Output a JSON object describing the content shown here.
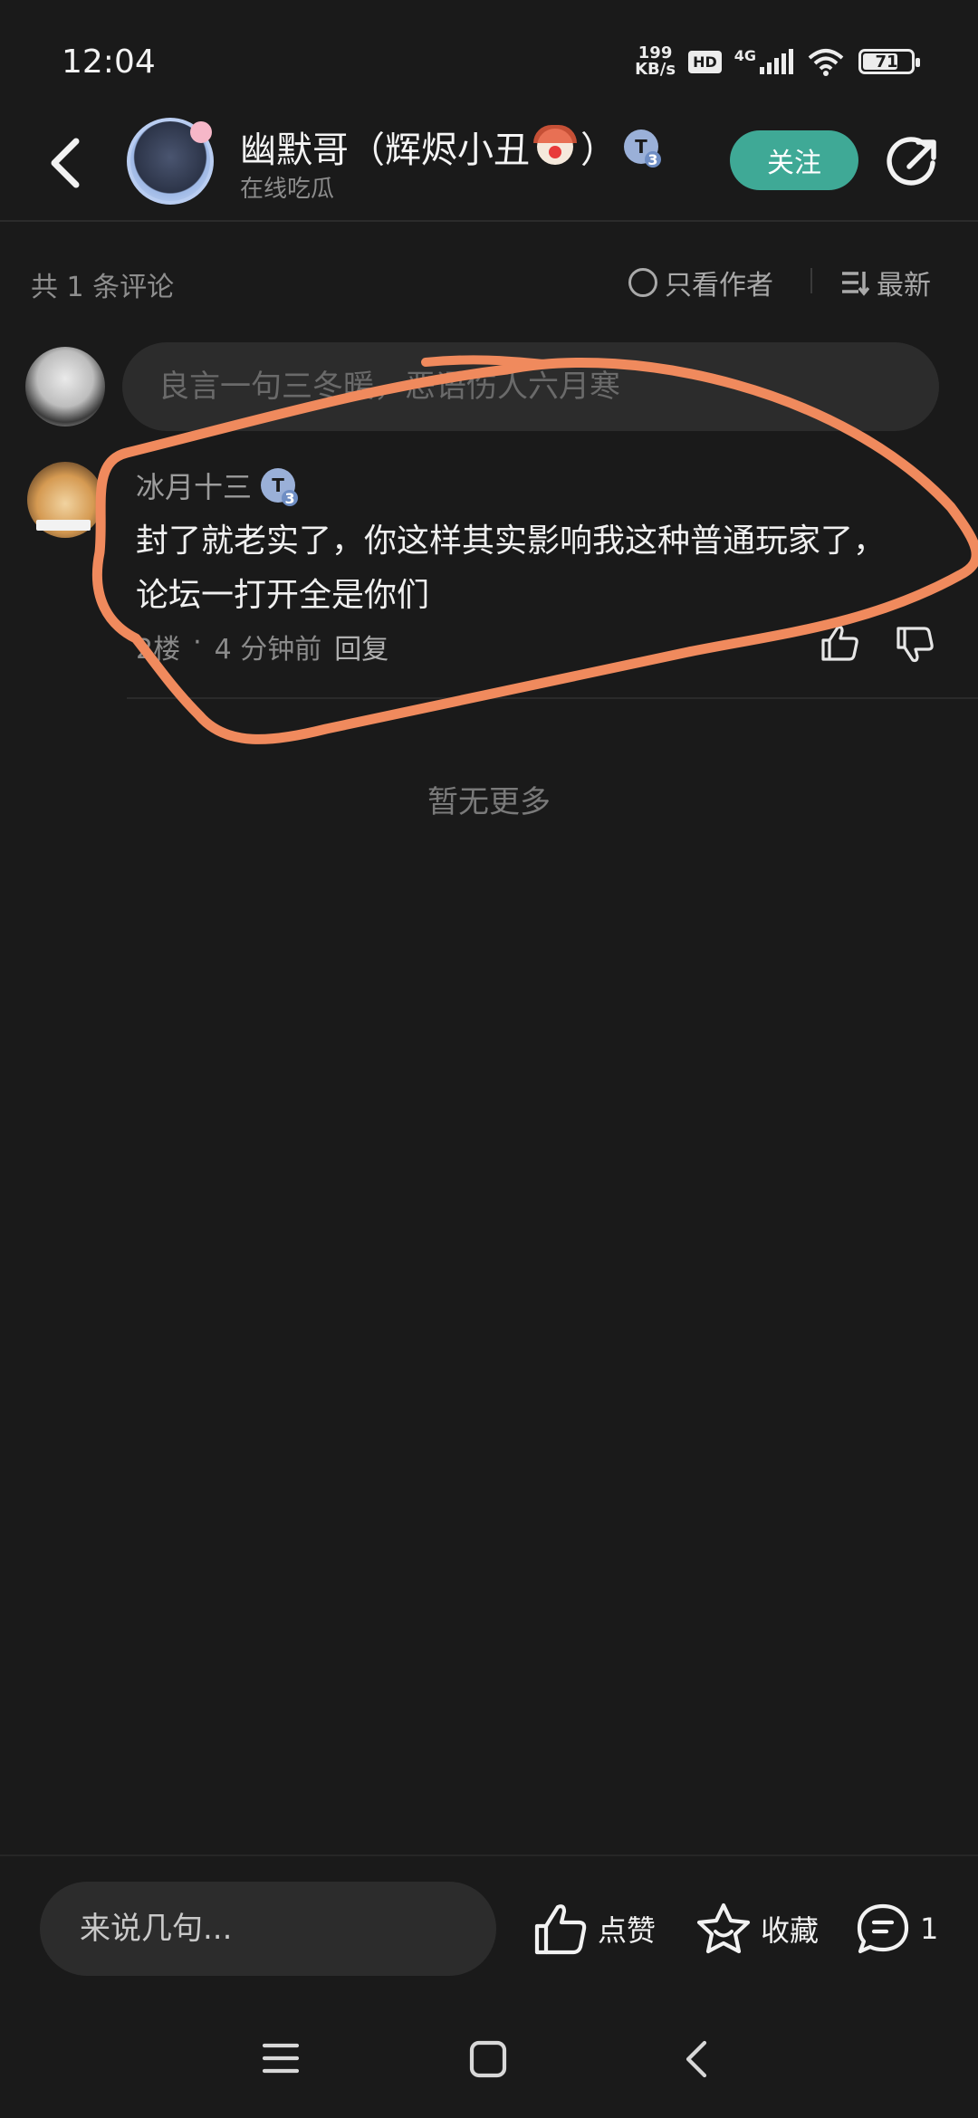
{
  "status_bar": {
    "time": "12:04",
    "net_speed_value": "199",
    "net_speed_unit": "KB/s",
    "hd": "HD",
    "network": "4G",
    "battery": "71"
  },
  "header": {
    "user_name": "幽默哥（辉烬小丑",
    "user_name_suffix": "）",
    "level_badge": "T",
    "level_num": "3",
    "subtitle": "在线吃瓜",
    "follow_label": "关注"
  },
  "comments_bar": {
    "count_label": "共 1 条评论",
    "only_author_label": "只看作者",
    "sort_label": "最新"
  },
  "reply_input": {
    "placeholder": "良言一句三冬暖，恶语伤人六月寒"
  },
  "comment": {
    "author": "冰月十三",
    "level_badge": "T",
    "level_num": "3",
    "text": "封了就老实了，你这样其实影响我这种普通玩家了，论坛一打开全是你们",
    "floor": "2楼",
    "time": "4 分钟前",
    "reply_label": "回复"
  },
  "no_more": "暂无更多",
  "bottom_bar": {
    "input_placeholder": "来说几句...",
    "like_label": "点赞",
    "fav_label": "收藏",
    "comment_count": "1"
  },
  "colors": {
    "background": "#1a1a1a",
    "accent": "#3fa996",
    "annotation": "#f08a5d"
  }
}
